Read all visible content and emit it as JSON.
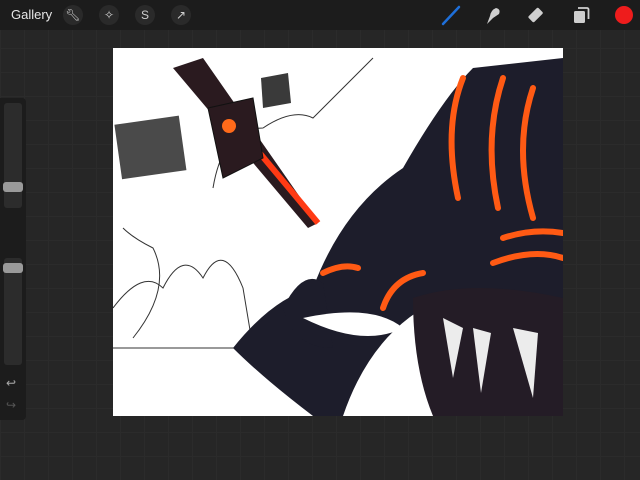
{
  "topbar": {
    "gallery_label": "Gallery",
    "left_tools": [
      "wrench-icon",
      "magic-wand-icon",
      "selection-icon",
      "transform-arrow-icon"
    ],
    "right_tools": [
      "brush-icon",
      "smudge-icon",
      "eraser-icon",
      "layers-icon"
    ],
    "brush_color": "#1e6fd9",
    "current_color": "#ee1c1c"
  },
  "sidebar": {
    "brush_size_level": 0.17,
    "opacity_level": 0.95,
    "icons": [
      "modify-square-icon",
      "undo-icon",
      "redo-icon"
    ]
  },
  "canvas": {
    "background": "#ffffff"
  }
}
